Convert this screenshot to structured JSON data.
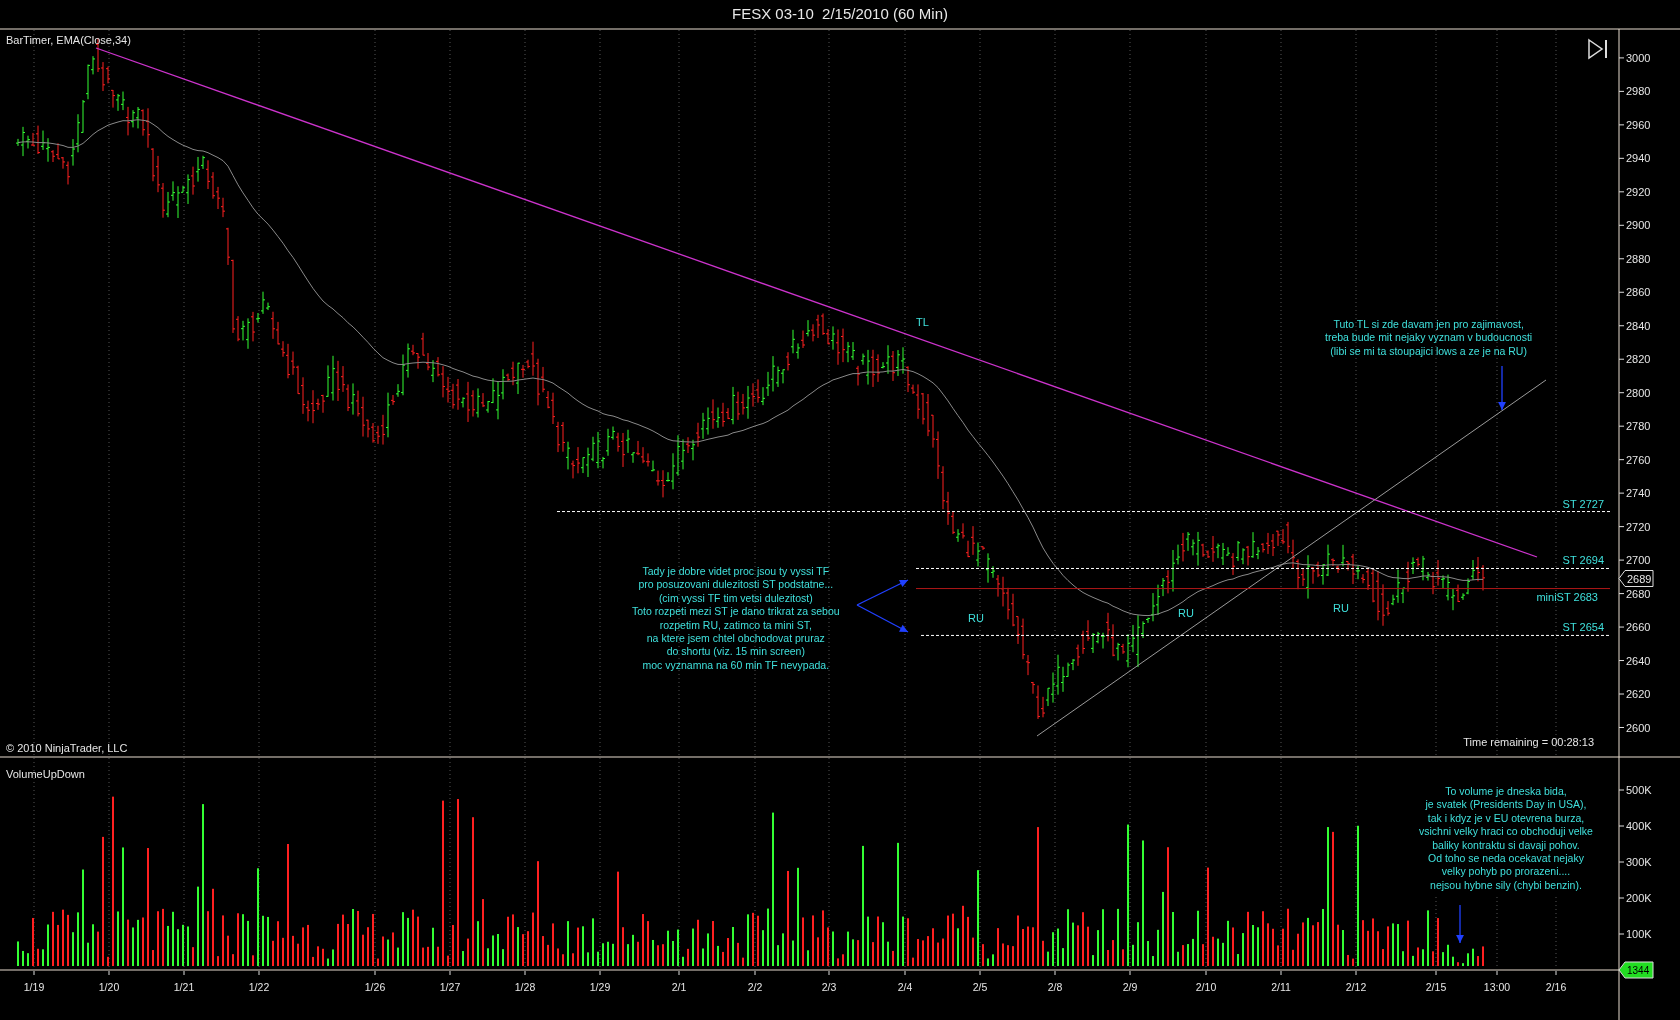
{
  "window": {
    "title": "FESX 03-10  2/15/2010 (60 Min)"
  },
  "price_panel": {
    "indicators_label": "BarTimer, EMA(Close,34)",
    "copyright": "© 2010 NinjaTrader, LLC",
    "time_remaining": "Time remaining = 00:28:13",
    "y_ticks": [
      "3000",
      "2980",
      "2960",
      "2940",
      "2920",
      "2900",
      "2880",
      "2860",
      "2840",
      "2820",
      "2800",
      "2780",
      "2760",
      "2740",
      "2720",
      "2700",
      "2680",
      "2660",
      "2640",
      "2620",
      "2600"
    ],
    "last_price": "2689",
    "trendline_label": "TL",
    "levels": [
      {
        "label": "ST 2727",
        "kind": "support"
      },
      {
        "label": "ST 2694",
        "kind": "support"
      },
      {
        "label": "miniST 2683",
        "kind": "mini"
      },
      {
        "label": "ST 2654",
        "kind": "support"
      }
    ],
    "range_labels": [
      "RU",
      "RU",
      "RU"
    ],
    "notes": [
      {
        "lines": [
          "Tady je dobre videt proc jsou ty vyssi TF",
          "pro posuzovani dulezitosti ST podstatne...",
          "(cim vyssi TF tim vetsi dulezitost)",
          "Toto rozpeti mezi ST je dano trikrat za sebou",
          "rozpetim RU, zatimco ta mini ST,",
          "na ktere jsem chtel obchodovat pruraz",
          "do shortu (viz. 15 min screen)",
          "moc vyznamna na 60 min TF nevypada."
        ]
      },
      {
        "lines": [
          "Tuto TL si zde davam jen pro zajimavost,",
          "treba bude mit nejaky vyznam v budoucnosti",
          "(libi se mi ta stoupajici lows a ze je na RU)"
        ]
      }
    ]
  },
  "volume_panel": {
    "label": "VolumeUpDown",
    "y_ticks": [
      "500K",
      "400K",
      "300K",
      "200K",
      "100K"
    ],
    "last_volume": "1344",
    "note": {
      "lines": [
        "To volume je dneska bida,",
        "je svatek (Presidents Day in USA),",
        "tak i kdyz je v EU otevrena burza,",
        "vsichni velky hraci co obchoduji velke",
        "baliky kontraktu si davaji pohov.",
        "Od toho se neda ocekavat nejaky",
        "velky pohyb po prorazeni....",
        "nejsou hybne sily (chybi benzin)."
      ]
    }
  },
  "x_axis": {
    "labels": [
      "1/19",
      "1/20",
      "1/21",
      "1/22",
      "1/26",
      "1/27",
      "1/28",
      "1/29",
      "2/1",
      "2/2",
      "2/3",
      "2/4",
      "2/5",
      "2/8",
      "2/9",
      "2/10",
      "2/11",
      "2/12",
      "2/15",
      "13:00",
      "2/16"
    ]
  }
}
